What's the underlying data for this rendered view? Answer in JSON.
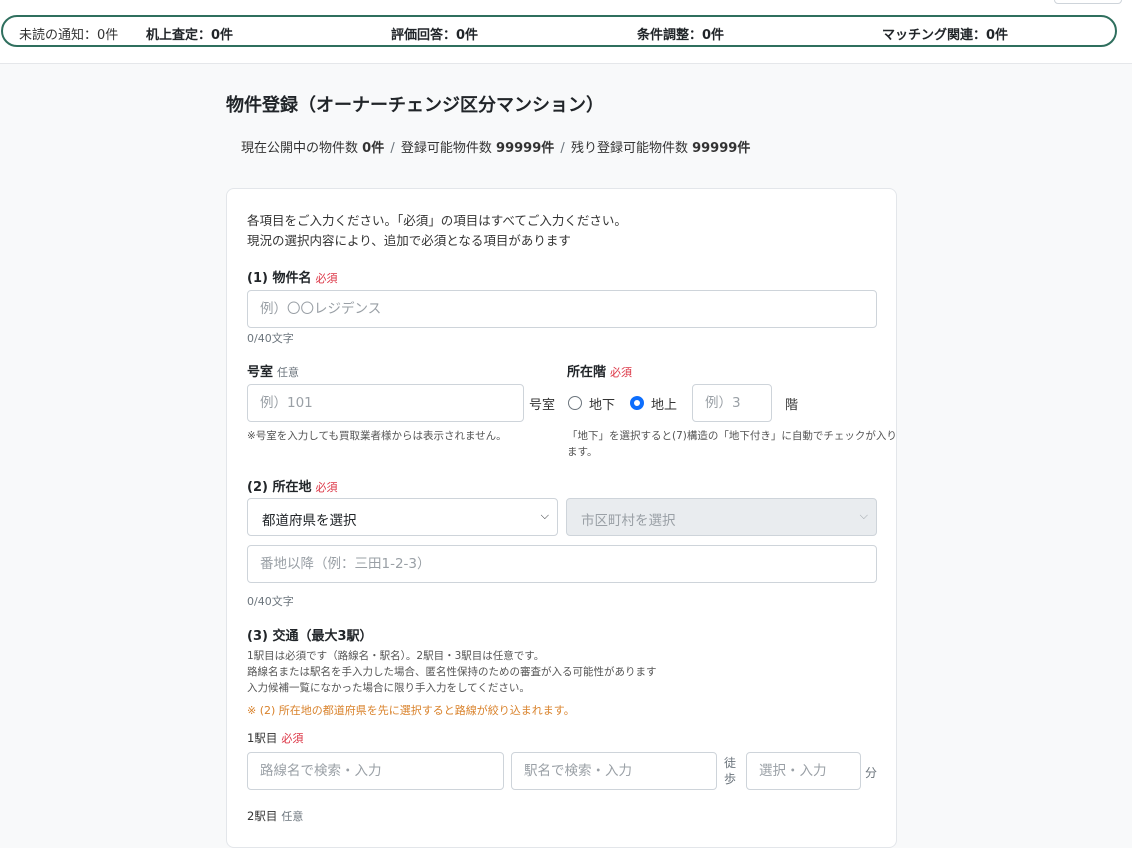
{
  "notifications": {
    "unread": "未読の通知：0件",
    "desk_assessment": "机上査定：0件",
    "evaluation_reply": "評価回答：0件",
    "condition_adjust": "条件調整：0件",
    "matching": "マッチング関連：0件"
  },
  "page": {
    "title": "物件登録（オーナーチェンジ区分マンション）",
    "summary": {
      "published_label": "現在公開中の物件数",
      "published_value": "0件",
      "registrable_label": "登録可能物件数",
      "registrable_value": "99999件",
      "remaining_label": "残り登録可能物件数",
      "remaining_value": "99999件",
      "separator": "/"
    }
  },
  "form": {
    "intro_line1": "各項目をご入力ください。「必須」の項目はすべてご入力ください。",
    "intro_line2": "現況の選択内容により、追加で必須となる項目があります",
    "required": "必須",
    "optional": "任意",
    "property_name": {
      "label": "(1) 物件名",
      "placeholder": "例）〇〇レジデンス",
      "counter": "0/40文字"
    },
    "room": {
      "label": "号室",
      "placeholder": "例）101",
      "suffix": "号室",
      "note": "※号室を入力しても買取業者様からは表示されません。"
    },
    "floor": {
      "label": "所在階",
      "option_underground": "地下",
      "option_above": "地上",
      "selected": "地上",
      "placeholder": "例）3",
      "suffix": "階",
      "note_line1": "「地下」を選択すると(7)構造の「地下付き」に自動でチェックが入り",
      "note_line2": "ます。"
    },
    "location": {
      "label": "(2) 所在地",
      "prefecture_select": "都道府県を選択",
      "city_select": "市区町村を選択",
      "address_placeholder": "番地以降（例：三田1-2-3）",
      "counter": "0/40文字"
    },
    "transport": {
      "label": "(3) 交通（最大3駅）",
      "note1": "1駅目は必須です（路線名・駅名）。2駅目・3駅目は任意です。",
      "note2": "路線名または駅名を手入力した場合、匿名性保持のための審査が入る可能性があります",
      "note3": "入力候補一覧になかった場合に限り手入力をしてください。",
      "warning": "※ (2) 所在地の都道府県を先に選択すると路線が絞り込まれます。",
      "station1_label": "1駅目",
      "station2_label": "2駅目",
      "line_placeholder": "路線名で検索・入力",
      "station_placeholder": "駅名で検索・入力",
      "walk_label_1": "徒",
      "walk_label_2": "歩",
      "minutes_placeholder": "選択・入力",
      "minutes_suffix": "分"
    }
  }
}
